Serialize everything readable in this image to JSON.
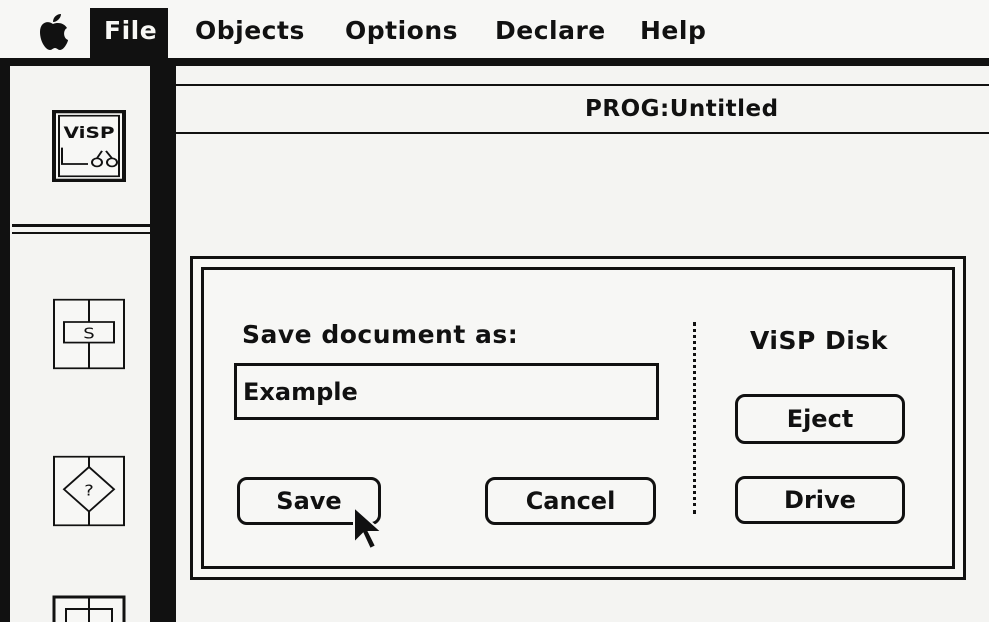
{
  "menubar": {
    "apple_icon": "apple-icon",
    "items": [
      {
        "label": "File"
      },
      {
        "label": "Objects"
      },
      {
        "label": "Options"
      },
      {
        "label": "Declare"
      },
      {
        "label": "Help"
      }
    ]
  },
  "palette": {
    "tools": [
      {
        "icon": "visp-program-icon",
        "label": "ViSP"
      },
      {
        "icon": "statement-icon",
        "label": "S"
      },
      {
        "icon": "decision-icon",
        "label": "?"
      },
      {
        "icon": "loop-icon"
      }
    ]
  },
  "window": {
    "title": "PROG:Untitled"
  },
  "dialog": {
    "prompt": "Save document as:",
    "filename_value": "Example",
    "save_label": "Save",
    "cancel_label": "Cancel",
    "disk_label": "ViSP Disk",
    "eject_label": "Eject",
    "drive_label": "Drive"
  }
}
